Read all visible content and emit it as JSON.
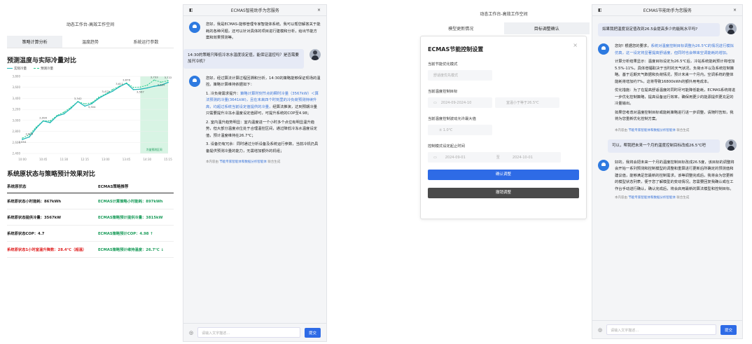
{
  "left": {
    "window_title": "动态工作台-高效工作空间",
    "tabs": [
      "策略计算分析",
      "温度趋势",
      "系统运行参数"
    ],
    "chart_title": "预测温度与实际冷量对比",
    "legend": [
      "实际冷量",
      "预测冷量"
    ],
    "table_title": "系统原状态与策略预计效果对比",
    "table_headers": [
      "系统原状态",
      "ECMAS策略推荐"
    ],
    "rows": [
      [
        "系统原状态小时能耗：867kWh",
        "ECMAS计算策略小时能耗：897kWh"
      ],
      [
        "系统原状态提供冷量：3567kW",
        "ECMAS策略预计提供冷量：3815kW"
      ],
      [
        "系统原状态COP：4.7",
        "ECMAS策略预计COP：4.98 ↑"
      ],
      [
        "系统原状态1小时室温升降数：28.4℃（超温）",
        "ECMAS策略预计维持温度：26.7℃ ↓"
      ]
    ]
  },
  "chart_data": {
    "type": "line",
    "x": [
      "10:00",
      "10:15",
      "10:30",
      "10:45",
      "11:00",
      "11:15",
      "11:30",
      "11:45",
      "12:00",
      "12:15",
      "12:30",
      "12:45",
      "13:00",
      "13:15",
      "13:30",
      "13:45",
      "14:00",
      "14:15",
      "14:30",
      "14:45",
      "15:00",
      "15:15"
    ],
    "xticks": [
      "10:00",
      "10:45",
      "11:30",
      "12:15",
      "13:00",
      "13:45",
      "14:30",
      "15:15"
    ],
    "yticks": [
      "2,400",
      "2,600",
      "2,800",
      "3,000",
      "3,200",
      "3,400",
      "3,600",
      "3,800"
    ],
    "ylim": [
      2400,
      3800
    ],
    "series": [
      {
        "name": "实际冷量",
        "values": [
          2654,
          2700,
          2860,
          2990,
          2960,
          3080,
          3120,
          3220,
          3342,
          3260,
          3304,
          3400,
          3471,
          3530,
          3612,
          3676,
          3560,
          3567,
          3590,
          3620,
          3640,
          3690
        ]
      },
      {
        "name": "预测冷量",
        "values": [
          2679,
          2740,
          2880,
          2990,
          2990,
          3090,
          3150,
          3240,
          3340,
          3300,
          3320,
          3420,
          3480,
          3560,
          3620,
          3680,
          3600,
          3605,
          3640,
          3733,
          3694,
          3722
        ]
      }
    ],
    "data_labels": [
      "2,654",
      "2,679",
      "2,990",
      "3,342",
      "3,304",
      "3,471",
      "3,612",
      "3,676",
      "3,567",
      "3,733",
      "3,694",
      "3,722"
    ],
    "annotation": "冷量预测区间",
    "colors": {
      "actual": "#22b8b8",
      "predicted": "#22cc88",
      "band": "#c8f0d8"
    }
  },
  "chat1": {
    "title": "ECMAS智能助手为您服务",
    "close": "×",
    "bot1": "您好，我是ECMAS-能够管理专家智能体系统。我可以帮您解答关于能耗的各种问题，还可以针对具体的项目进行建模和分析，给出节能方案和效果预测等。",
    "user1": "14:30的策略只降低冷冻水温度设定值，能保证温控吗？是否需要加开冷机？",
    "bot2_intro": "您好，经过算法计算过程回溯和分析，14:30的策略能够保证现场的温控。策略计算维持依据如下：",
    "bot2_p1a": "1. 冷负荷需求提升：",
    "bot2_p1b": "策略计算时刻节点的瞬时冷量（3567kW）＜算法预测的冷量(3641kW)，且在未来四个时刻里的冷负荷预测持续升高，均超过系统当前设定值提供的冷量，",
    "bot2_p1c": "经算法推演，达到预期冷量只需要提升冷冻水温度设定值即可，可提升系统的COP至4.98；",
    "bot2_p2": "2. 室内温升趋势明显：室内温度进一个小时多个点位有明显温升趋势，但大部分温度点位处于合理温控区间，通过降低冷冻水温度设定值，预计温度维持在26.7℃；",
    "bot2_p3": "3. 设备仍有冗余：同时通过分析设备及系统运行参数，当前冷机仍具备提供预测冷量的能力，无需增加额外的机组；",
    "src_pre": "本内容由 ",
    "src_link": "节能专家智能体和数据分析智能体",
    "src_post": " 联合生成",
    "input_placeholder": "请输入文字描述…",
    "send": "提交"
  },
  "form": {
    "window_title": "动态工作台-高效工作空间",
    "tabs": [
      "模型更新情况",
      "目标调整确认"
    ],
    "title": "ECMAS节能控制设置",
    "close": "×",
    "f1_label": "当前节能优化模式",
    "f1_value": "舒适度优先模式",
    "f2_label": "当前温度控制目标",
    "f2_date": "2024-09-2024-10",
    "f2_value": "室温小于等于26.5℃",
    "f3_label": "当前温度控制波动允许最大值",
    "f3_value": "± 1.0℃",
    "f4_label": "控制模式设定起止时间",
    "f4_start": "2024-09-01",
    "f4_to": "至",
    "f4_end": "2024-10-01",
    "confirm": "确认调整",
    "cancel": "撤销调整"
  },
  "chat2": {
    "title": "ECMAS节能助手为您服务",
    "close": "×",
    "user1": "如果我把温度设定值改到26.5会提高多少的能耗水平吗?",
    "bot1_a": "您好! 根据您的要求，",
    "bot1_b": "系统对温度控制目标调整为26.5℃的情况进行模拟仿真，这一设定将显著提高舒适度，但同时也会带来空调能耗的增加。",
    "bot1_p2": "计算分析结果显示：温度目标设定为26.5℃后，冷站系统能耗预计将增加5.5%-11%，具体增幅取决于当时的天气状况、负荷水平以及系统控制策略。基于近期天气数据和负荷情况，预计未来一个月内，空调系统的整体能耗将增加约7%，这将导致16800kWh的额外用电成本。",
    "bot1_p3": "优化措施：为了在提高舒适温度的同时尽可能降低能耗，ECMAS系统将进一步优化控制策略，提高设备运行效率，确保用更少的能源提供更充足的冷量输出。",
    "bot1_p4": "如果您考虑对温度控制目标或能耗策略进行进一步调整，请随时告知，我将为您重新优化控制方案。",
    "src_pre": "本内容由 ",
    "src_link": "节能专家智能体和数据分析智能体",
    "src_post": " 联合生成",
    "user2": "可以，帮我把未来一个月的温度控制目标改成26.5℃吧",
    "bot2": "好的，我将会把未来一个月的温度控制目标改成26.5度，该目标的调整将会开始一系列预测和控制模型的调整和重算进行更新后所确定的预测值和建议值，能够满足您最新的控制需求。该等调整完成后，我将会为您更新的模型状态列表，便于您了解模型的变动情况。您需要回复我确认或在工作台手动进行确认，确认完成后，将会启用最新的算法模型和控制目标。",
    "src2_pre": "本内容由 ",
    "src2_link": "节能专家智能体和数据分析智能体",
    "src2_post": " 联合生成",
    "input_placeholder": "请输入文字描述…",
    "send": "提交"
  }
}
